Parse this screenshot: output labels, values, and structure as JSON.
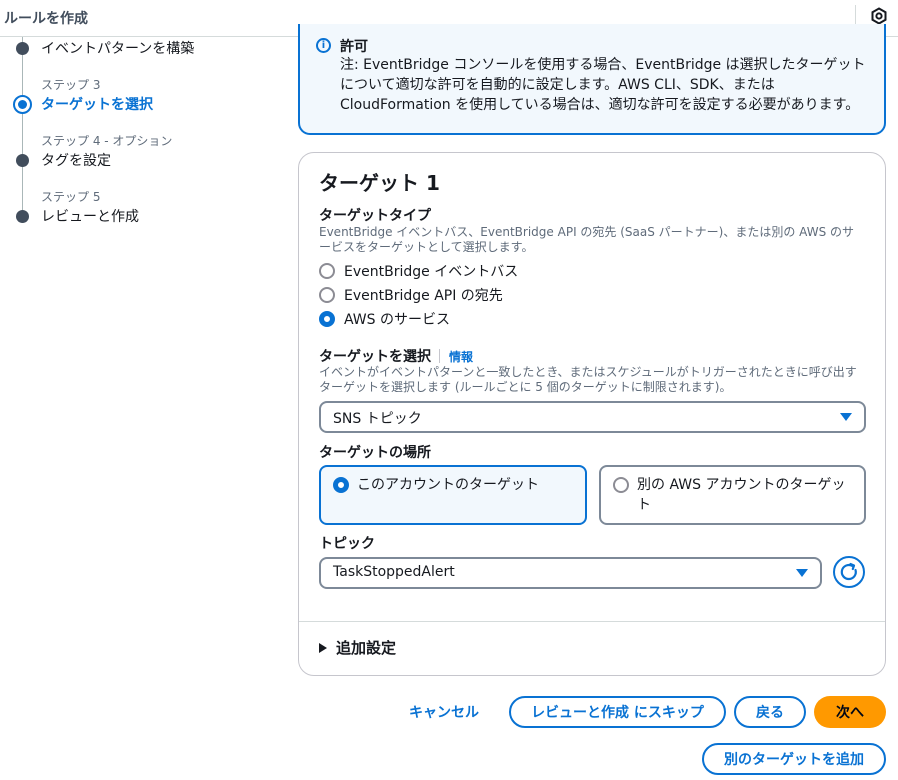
{
  "header": {
    "title": "ルールを作成"
  },
  "steps": [
    {
      "label": "",
      "name": "イベントパターンを構築",
      "state": "complete"
    },
    {
      "label": "ステップ 3",
      "name": "ターゲットを選択",
      "state": "active"
    },
    {
      "label": "ステップ 4 - オプション",
      "name": "タグを設定",
      "state": "pending"
    },
    {
      "label": "ステップ 5",
      "name": "レビューと作成",
      "state": "pending"
    }
  ],
  "alert": {
    "title": "許可",
    "body": "注: EventBridge コンソールを使用する場合、EventBridge は選択したターゲットについて適切な許可を自動的に設定します。AWS CLI、SDK、または CloudFormation を使用している場合は、適切な許可を設定する必要があります。"
  },
  "target": {
    "heading": "ターゲット 1",
    "type_label": "ターゲットタイプ",
    "type_description": "EventBridge イベントバス、EventBridge API の宛先 (SaaS パートナー)、または別の AWS のサービスをターゲットとして選択します。",
    "type_options": [
      {
        "label": "EventBridge イベントバス",
        "checked": false
      },
      {
        "label": "EventBridge API の宛先",
        "checked": false
      },
      {
        "label": "AWS のサービス",
        "checked": true
      }
    ],
    "select_label": "ターゲットを選択",
    "select_info": "情報",
    "select_description": "イベントがイベントパターンと一致したとき、またはスケジュールがトリガーされたときに呼び出すターゲットを選択します (ルールごとに 5 個のターゲットに制限されます)。",
    "select_value": "SNS トピック",
    "location_label": "ターゲットの場所",
    "location_options": [
      {
        "label": "このアカウントのターゲット",
        "checked": true
      },
      {
        "label": "別の AWS アカウントのターゲット",
        "checked": false
      }
    ],
    "topic_label": "トピック",
    "topic_value": "TaskStoppedAlert",
    "additional_settings": "追加設定"
  },
  "actions": {
    "cancel": "キャンセル",
    "skip": "レビューと作成 にスキップ",
    "back": "戻る",
    "next": "次へ",
    "add_target": "別のターゲットを追加"
  },
  "colors": {
    "accent": "#0972d3",
    "primary_button": "#ff9900",
    "alert_bg": "#f2f8fd"
  }
}
